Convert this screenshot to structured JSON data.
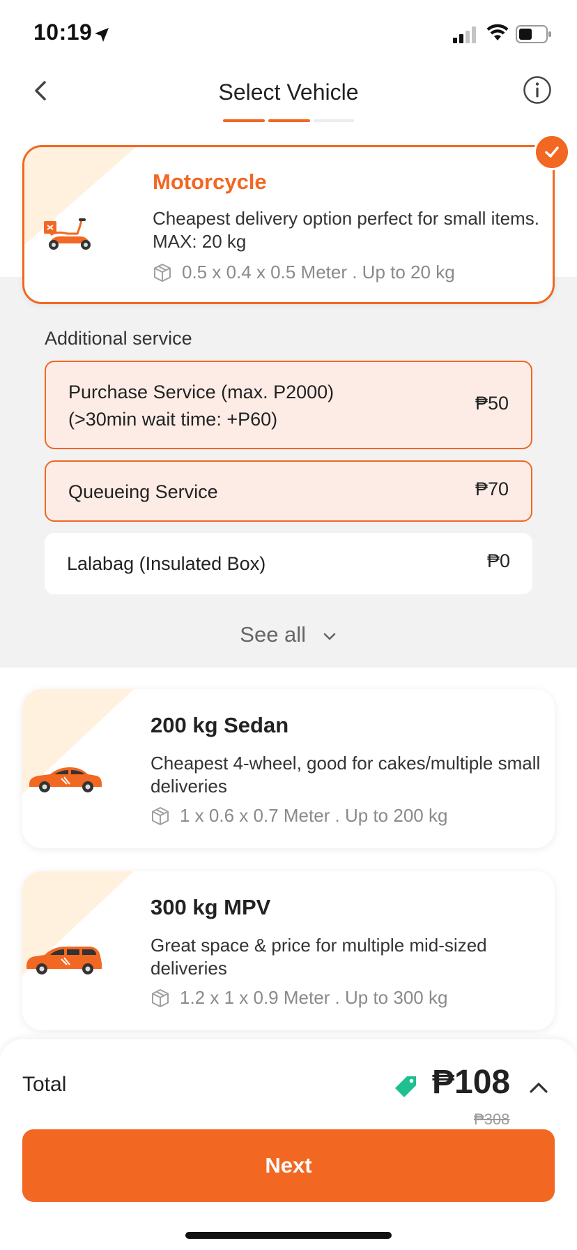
{
  "status_bar": {
    "time": "10:19"
  },
  "header": {
    "title": "Select Vehicle"
  },
  "colors": {
    "accent": "#f26722",
    "selected_bg": "#fdece6",
    "discount_tag": "#1fbf8f"
  },
  "vehicles": [
    {
      "name": "Motorcycle",
      "description": "Cheapest delivery option perfect for small items. MAX: 20 kg",
      "dimensions": "0.5 x 0.4 x 0.5 Meter . Up to 20 kg",
      "selected": true
    },
    {
      "name": "200 kg Sedan",
      "description": "Cheapest 4-wheel, good for cakes/multiple small deliveries",
      "dimensions": "1 x 0.6 x 0.7 Meter . Up to 200 kg",
      "selected": false
    },
    {
      "name": "300 kg MPV",
      "description": "Great space & price for multiple mid-sized deliveries",
      "dimensions": "1.2 x 1 x 0.9 Meter . Up to 300 kg",
      "selected": false
    }
  ],
  "additional_service": {
    "label": "Additional service",
    "items": [
      {
        "line1": "Purchase Service (max. P2000)",
        "line2": "(>30min wait time: +P60)",
        "price": "₱50",
        "selected": true
      },
      {
        "line1": "Queueing Service",
        "price": "₱70",
        "selected": true
      },
      {
        "line1": "Lalabag (Insulated Box)",
        "price": "₱0",
        "selected": false
      }
    ],
    "see_all": "See all"
  },
  "footer": {
    "total_label": "Total",
    "total_price": "₱108",
    "original_price": "₱308",
    "next_label": "Next"
  }
}
